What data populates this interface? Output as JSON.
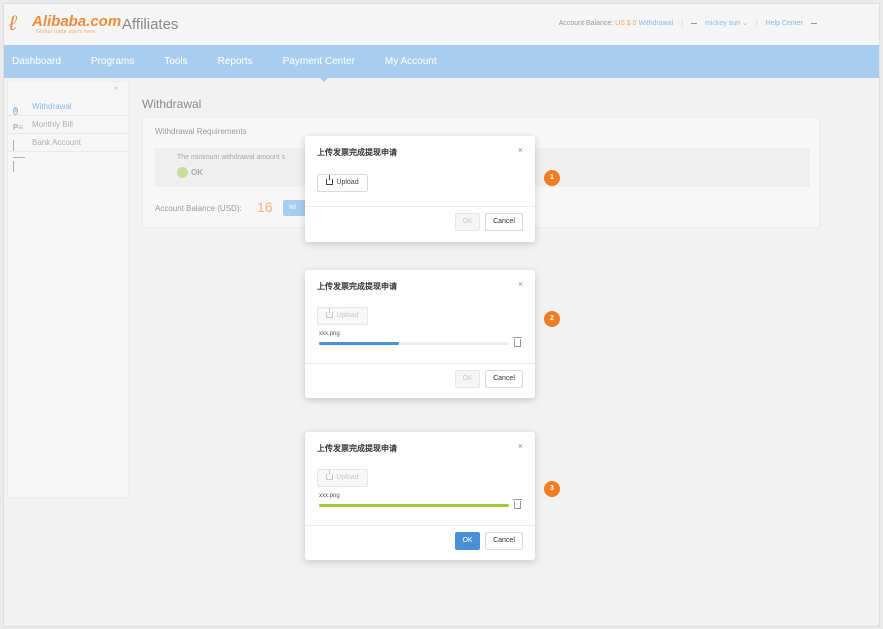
{
  "brand": {
    "logo_text": "Alibaba.com",
    "logo_sub": "Global trade starts here.",
    "app_title": "Affiliates"
  },
  "header_right": {
    "balance_label": "Account Balance:",
    "balance_value": "US $ 0",
    "withdrawal_link": "Withdrawal",
    "user": "mickey sun",
    "help": "Help Center"
  },
  "nav": {
    "items": [
      {
        "label": "Dashboard"
      },
      {
        "label": "Programs"
      },
      {
        "label": "Tools"
      },
      {
        "label": "Reports"
      },
      {
        "label": "Payment Center"
      },
      {
        "label": "My Account"
      }
    ],
    "active_index": 4
  },
  "sidebar": {
    "close_glyph": "×",
    "items": [
      {
        "label": "Withdrawal",
        "icon": "dollar-circle-icon"
      },
      {
        "label": "Monthly Bill",
        "icon": "parking-bill-icon"
      },
      {
        "label": "Bank Account",
        "icon": "card-icon"
      }
    ]
  },
  "main": {
    "title": "Withdrawal",
    "requirements_heading": "Withdrawal Requirements",
    "requirement_text": "The minimum withdrawal amount s",
    "ok_label": "OK",
    "balance_label": "Account Balance (USD):",
    "balance_value": "16",
    "withdraw_button_label": "Wi"
  },
  "dialogs": [
    {
      "title": "上传发票完成提现申请",
      "upload_label": "Upload",
      "ok_label": "OK",
      "cancel_label": "Cancel",
      "step": "1"
    },
    {
      "title": "上传发票完成提现申请",
      "upload_label": "Upload",
      "file_name": "xxx.png",
      "progress": 0.42,
      "progress_color": "#4a90d9",
      "ok_label": "OK",
      "cancel_label": "Cancel",
      "step": "2"
    },
    {
      "title": "上传发票完成提现申请",
      "upload_label": "Upload",
      "file_name": "xxx.png",
      "progress": 1.0,
      "progress_color": "#9ccc3c",
      "ok_label": "OK",
      "cancel_label": "Cancel",
      "step": "3"
    }
  ],
  "colors": {
    "nav_bg": "#a9cdee",
    "accent_orange": "#ef7d23",
    "primary_blue": "#4a90d9"
  }
}
